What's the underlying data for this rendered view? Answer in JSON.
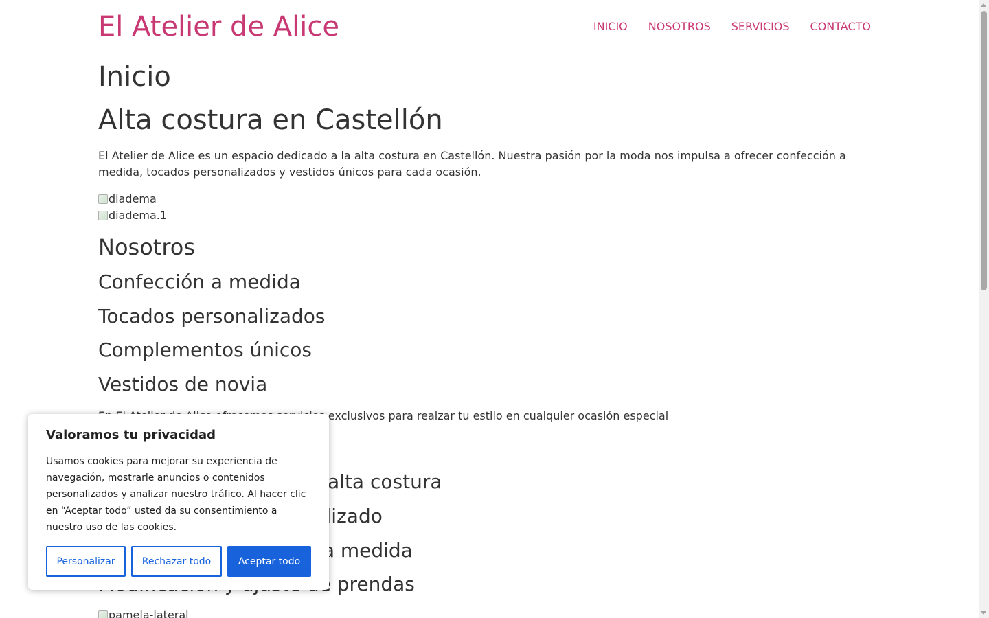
{
  "site": {
    "title": "El Atelier de Alice",
    "brand_color": "#c83872"
  },
  "nav": {
    "items": [
      {
        "label": "INICIO"
      },
      {
        "label": "NOSOTROS"
      },
      {
        "label": "SERVICIOS"
      },
      {
        "label": "CONTACTO"
      }
    ]
  },
  "main": {
    "page_heading": "Inicio",
    "headline": "Alta costura en Castellón",
    "intro": "El Atelier de Alice es un espacio dedicado a la alta costura en Castellón. Nuestra pasión por la moda nos impulsa a ofrecer confección a medida, tocados personalizados y vestidos únicos para cada ocasión.",
    "images": [
      {
        "alt": "diadema"
      },
      {
        "alt": "diadema.1"
      },
      {
        "alt": "pamela-lateral"
      }
    ],
    "nosotros": {
      "heading": "Nosotros",
      "items": [
        "Confección a medida",
        "Tocados personalizados",
        "Complementos únicos",
        "Vestidos de novia"
      ],
      "lead": "En El Atelier de Alice ofrecemos servicios exclusivos para realzar tu estilo en cualquier ocasión especial"
    },
    "services": [
      "Diseño y confección de alta costura",
      "Asesoramiento personalizado",
      "Confección de tocados a medida",
      "Modificación y ajuste de prendas"
    ]
  },
  "cookie_banner": {
    "title": "Valoramos tu privacidad",
    "text": "Usamos cookies para mejorar su experiencia de navegación, mostrarle anuncios o contenidos personalizados y analizar nuestro tráfico. Al hacer clic en “Aceptar todo” usted da su consentimiento a nuestro uso de las cookies.",
    "customize_label": "Personalizar",
    "reject_label": "Rechazar todo",
    "accept_label": "Aceptar todo",
    "accent_color": "#1863dc"
  }
}
